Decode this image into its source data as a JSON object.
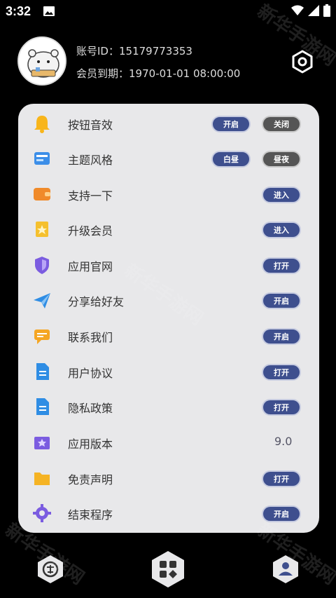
{
  "status": {
    "time": "3:32"
  },
  "profile": {
    "account_label": "账号ID：",
    "account_id": "15179773353",
    "expire_label": "会员到期：",
    "expire_date": "1970-01-01 08:00:00"
  },
  "menu": [
    {
      "label": "按钮音效",
      "icon": "bell-icon",
      "buttons": [
        "开启",
        "关闭"
      ]
    },
    {
      "label": "主题风格",
      "icon": "theme-icon",
      "buttons": [
        "白昼",
        "昼夜"
      ]
    },
    {
      "label": "支持一下",
      "icon": "wallet-icon",
      "buttons": [
        "进入"
      ]
    },
    {
      "label": "升级会员",
      "icon": "vip-card-icon",
      "buttons": [
        "进入"
      ]
    },
    {
      "label": "应用官网",
      "icon": "shield-icon",
      "buttons": [
        "打开"
      ]
    },
    {
      "label": "分享给好友",
      "icon": "paper-plane-icon",
      "buttons": [
        "开启"
      ]
    },
    {
      "label": "联系我们",
      "icon": "chat-icon",
      "buttons": [
        "开启"
      ]
    },
    {
      "label": "用户协议",
      "icon": "document-icon",
      "buttons": [
        "打开"
      ]
    },
    {
      "label": "隐私政策",
      "icon": "document-icon",
      "buttons": [
        "打开"
      ]
    },
    {
      "label": "应用版本",
      "icon": "version-icon",
      "value": "9.0"
    },
    {
      "label": "免责声明",
      "icon": "folder-icon",
      "buttons": [
        "打开"
      ]
    },
    {
      "label": "结束程序",
      "icon": "gear-icon",
      "buttons": [
        "开启"
      ]
    }
  ],
  "colors": {
    "accent": "#3e4f8e",
    "panel": "#e8e8ea",
    "muted": "#555555"
  },
  "watermark": "新华手游网"
}
